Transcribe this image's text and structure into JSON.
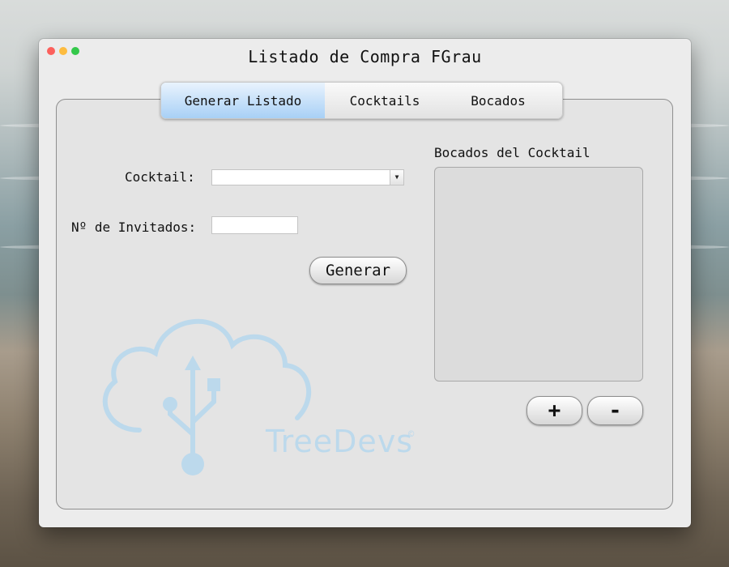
{
  "window": {
    "title": "Listado de Compra FGrau"
  },
  "tabs": [
    {
      "label": "Generar Listado",
      "active": true
    },
    {
      "label": "Cocktails",
      "active": false
    },
    {
      "label": "Bocados",
      "active": false
    }
  ],
  "form": {
    "cocktail_label": "Cocktail:",
    "cocktail_value": "",
    "invitados_label": "Nº de Invitados:",
    "invitados_value": "",
    "generar_button": "Generar"
  },
  "bocados": {
    "title": "Bocados del Cocktail",
    "items": [],
    "add_button": "+",
    "remove_button": "-"
  },
  "watermark": {
    "text": "TreeDevs",
    "mark": "©",
    "color": "#bcd9ec"
  },
  "colors": {
    "tab_active": "#a8d0f6",
    "close": "#fc605c",
    "minimize": "#fdbc40",
    "maximize": "#34c84a"
  }
}
